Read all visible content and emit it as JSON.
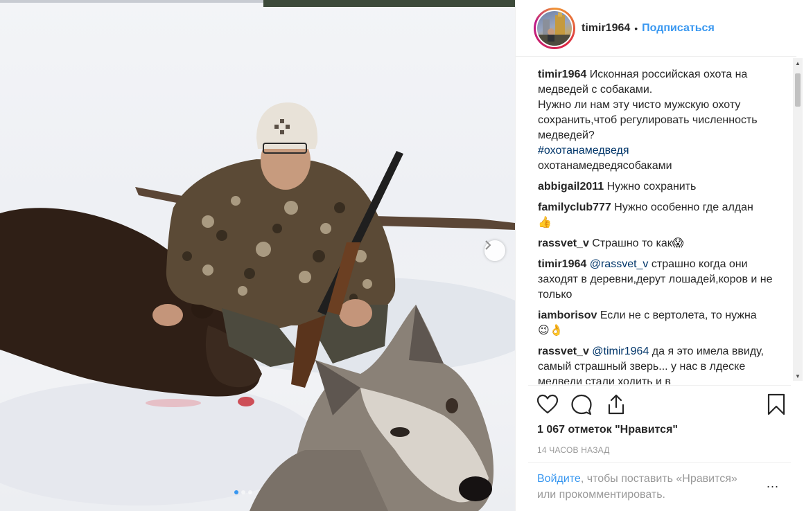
{
  "header": {
    "username": "timir1964",
    "separator": "•",
    "follow_label": "Подписаться"
  },
  "photo": {
    "slide_count": 3,
    "active_slide": 1,
    "next_icon": "chevron-right-icon"
  },
  "comments": [
    {
      "user": "timir1964",
      "lines": [
        "Исконная российская охота на медведей с собаками.",
        "Нужно ли нам эту чисто мужскую охоту сохранить,чтоб регулировать численность медведей?"
      ],
      "hashtag": "#охотанамедведя",
      "extra": "охотанамедведясобаками"
    },
    {
      "user": "abbigail2011",
      "text": "Нужно сохранить"
    },
    {
      "user": "familyclub777",
      "text": "Нужно особенно где алдан",
      "emoji": "👍"
    },
    {
      "user": "rassvet_v",
      "text": "Страшно то как",
      "emoji": "😱"
    },
    {
      "user": "timir1964",
      "mention": "@rassvet_v",
      "text": "страшно когда они заходят в деревни,дерут лошадей,коров и не только"
    },
    {
      "user": "iamborisov",
      "text": "Если не с вертолета, то нужна",
      "emoji": "😉👌"
    },
    {
      "user": "rassvet_v",
      "mention": "@timir1964",
      "text": "да я это имела ввиду, самый страшный зверь... у нас в лдеске медведи стали ходить и в"
    }
  ],
  "actions": {
    "like_icon": "heart-icon",
    "comment_icon": "comment-icon",
    "share_icon": "share-icon",
    "save_icon": "bookmark-icon"
  },
  "likes": {
    "text": "1 067 отметок \"Нравится\""
  },
  "timestamp": "14 часов назад",
  "login_prompt": {
    "link": "Войдите",
    "text": ", чтобы поставить «Нравится» или прокомментировать.",
    "more": "..."
  },
  "colors": {
    "link_blue": "#3897f0",
    "hashtag_blue": "#003569",
    "text": "#262626",
    "muted": "#999999",
    "divider": "#efefef"
  }
}
